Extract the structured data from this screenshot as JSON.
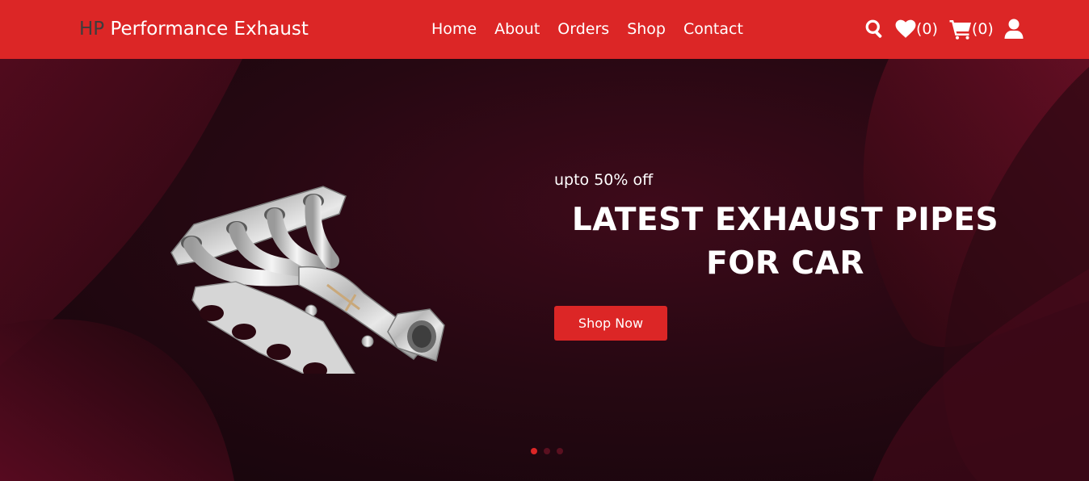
{
  "brand": {
    "mark": "HP",
    "name": " Performance Exhaust"
  },
  "nav": {
    "items": [
      {
        "label": "Home"
      },
      {
        "label": "About"
      },
      {
        "label": "Orders"
      },
      {
        "label": "Shop"
      },
      {
        "label": "Contact"
      }
    ]
  },
  "icons": {
    "search": "search-icon",
    "wishlist": "heart-icon",
    "cart": "cart-icon",
    "account": "user-icon"
  },
  "counts": {
    "wishlist": "(0)",
    "cart": "(0)"
  },
  "hero": {
    "offer": "upto 50% off",
    "title": "LATEST EXHAUST PIPES FOR CAR",
    "cta": "Shop Now",
    "slides": 3,
    "active_slide": 1
  },
  "colors": {
    "accent": "#dc2626",
    "brand_mark": "#3d3d3d",
    "hero_dark": "#1a0810",
    "hero_maroon": "#6b0f24"
  }
}
